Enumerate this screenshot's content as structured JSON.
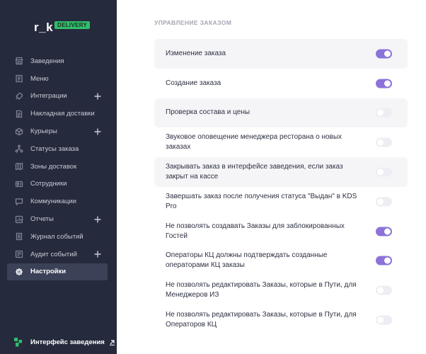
{
  "brand": {
    "logo_text": "r_k",
    "badge": "DELIVERY"
  },
  "sidebar": {
    "items": [
      {
        "label": "Заведения",
        "icon": "store-icon",
        "expandable": false,
        "active": false
      },
      {
        "label": "Меню",
        "icon": "menu-book-icon",
        "expandable": false,
        "active": false
      },
      {
        "label": "Интеграции",
        "icon": "rocket-icon",
        "expandable": true,
        "active": false
      },
      {
        "label": "Накладная доставки",
        "icon": "document-icon",
        "expandable": false,
        "active": false
      },
      {
        "label": "Курьеры",
        "icon": "cube-icon",
        "expandable": true,
        "active": false
      },
      {
        "label": "Статусы заказа",
        "icon": "flow-icon",
        "expandable": false,
        "active": false
      },
      {
        "label": "Зоны доставок",
        "icon": "map-icon",
        "expandable": false,
        "active": false
      },
      {
        "label": "Сотрудники",
        "icon": "id-card-icon",
        "expandable": false,
        "active": false
      },
      {
        "label": "Коммуникации",
        "icon": "chat-icon",
        "expandable": false,
        "active": false
      },
      {
        "label": "Отчеты",
        "icon": "report-icon",
        "expandable": true,
        "active": false
      },
      {
        "label": "Журнал событий",
        "icon": "journal-icon",
        "expandable": false,
        "active": false
      },
      {
        "label": "Аудит событий",
        "icon": "audit-icon",
        "expandable": true,
        "active": false
      },
      {
        "label": "Настройки",
        "icon": "gear-icon",
        "expandable": false,
        "active": true
      }
    ],
    "footer": {
      "label": "Интерфейс заведения",
      "icon": "venue-interface-icon"
    }
  },
  "main": {
    "section_title": "УПРАВЛЕНИЕ ЗАКАЗОМ",
    "settings": [
      {
        "label": "Изменение заказа",
        "enabled": true,
        "shaded": true
      },
      {
        "label": "Создание заказа",
        "enabled": true,
        "shaded": false
      },
      {
        "label": "Проверка состава и цены",
        "enabled": false,
        "shaded": true
      },
      {
        "label": "Звуковое оповещение менеджера ресторана о новых заказах",
        "enabled": false,
        "shaded": false
      },
      {
        "label": "Закрывать заказ в интерфейсе заведения, если заказ закрыт на кассе",
        "enabled": false,
        "shaded": true
      },
      {
        "label": "Завершать заказ после получения статуса \"Выдан\" в KDS Pro",
        "enabled": false,
        "shaded": false
      },
      {
        "label": "Не позволять создавать Заказы для заблокированных Гостей",
        "enabled": true,
        "shaded": false
      },
      {
        "label": "Операторы КЦ должны подтверждать созданные операторами КЦ заказы",
        "enabled": true,
        "shaded": false
      },
      {
        "label": "Не позволять редактировать Заказы, которые в Пути, для Менеджеров ИЗ",
        "enabled": false,
        "shaded": false
      },
      {
        "label": "Не позволять редактировать Заказы, которые в Пути, для Операторов КЦ",
        "enabled": false,
        "shaded": false
      }
    ]
  },
  "colors": {
    "sidebar_bg": "#262a3d",
    "accent": "#8b73d9",
    "brand_green": "#2fbf6b",
    "active_item_bg": "#3b4157"
  }
}
